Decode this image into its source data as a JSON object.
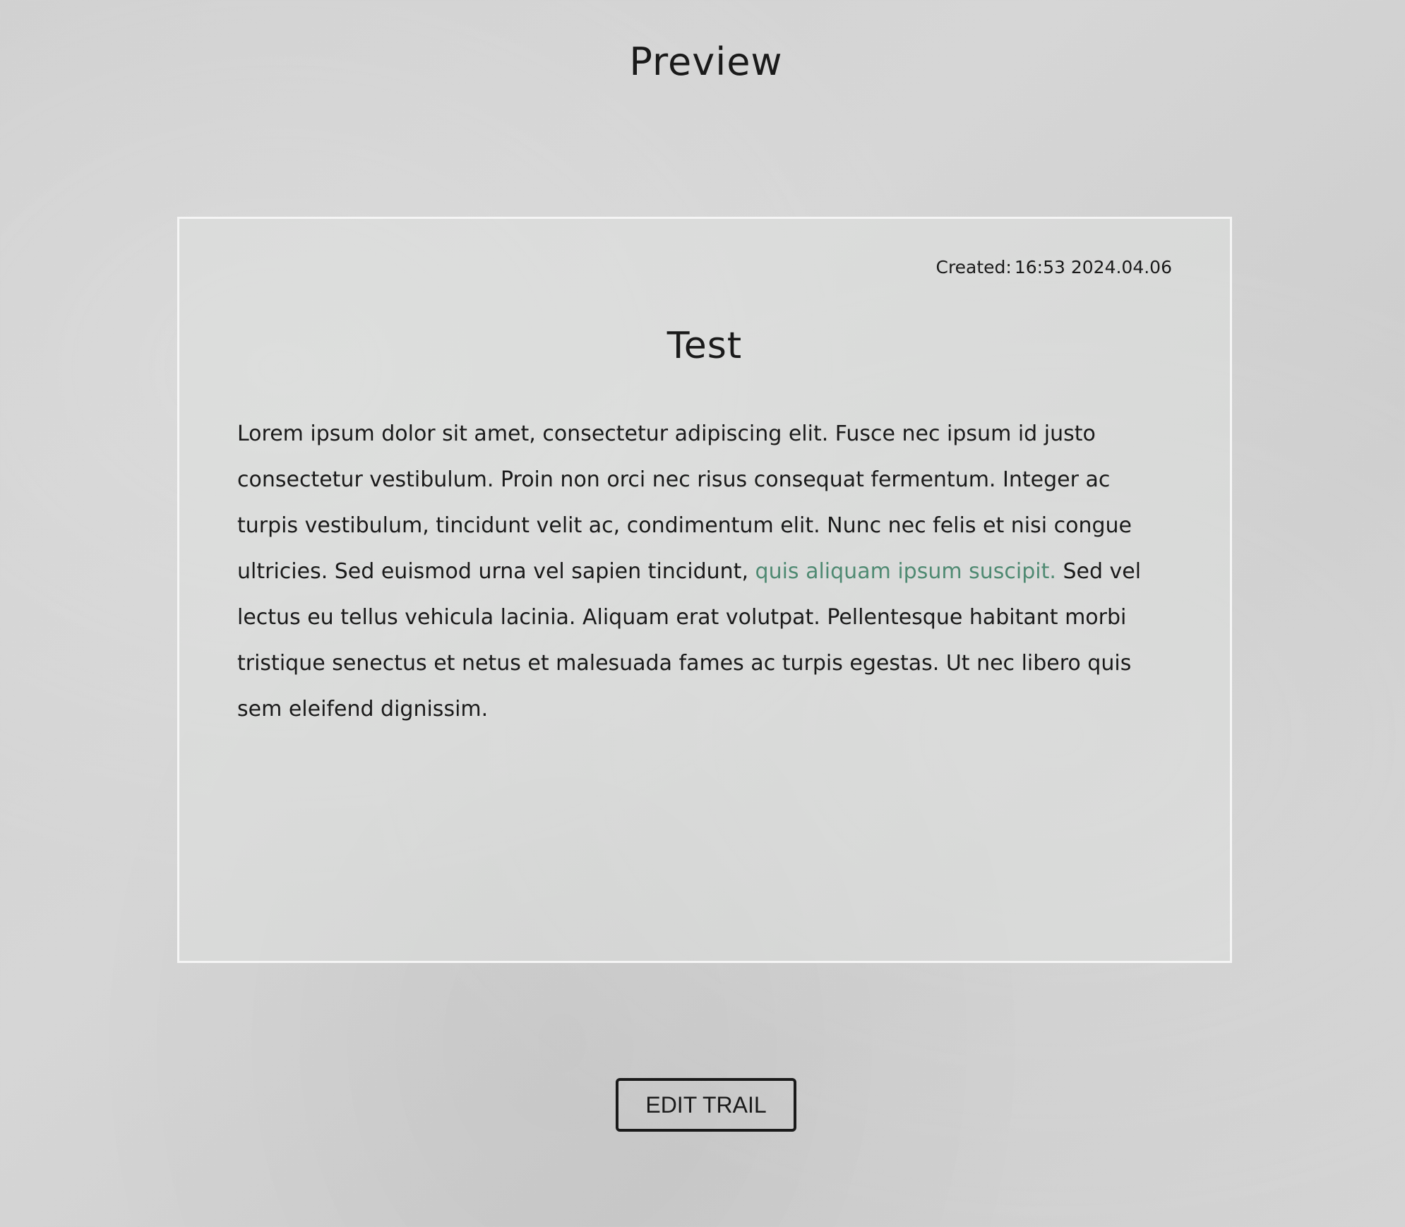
{
  "page": {
    "title": "Preview"
  },
  "card": {
    "created_label": "Created:",
    "created_value": "16:53 2024.04.06",
    "title": "Test",
    "body_before_link": "Lorem ipsum dolor sit amet, consectetur adipiscing elit. Fusce nec ipsum id justo consectetur vestibulum. Proin non orci nec risus consequat fermentum. Integer ac turpis vestibulum, tincidunt velit ac, condimentum elit. Nunc nec felis et nisi congue ultricies. Sed euismod urna vel sapien tincidunt, ",
    "body_link": "quis aliquam ipsum suscipit.",
    "body_after_link": " Sed vel lectus eu tellus vehicula lacinia. Aliquam erat volutpat. Pellentesque habitant morbi tristique senectus et netus et malesuada fames ac turpis egestas. Ut nec libero quis sem eleifend dignissim."
  },
  "actions": {
    "edit_label": "EDIT TRAIL"
  },
  "colors": {
    "link": "#4f8a72",
    "card_border": "#f5f5f5",
    "text": "#1a1a1a"
  }
}
